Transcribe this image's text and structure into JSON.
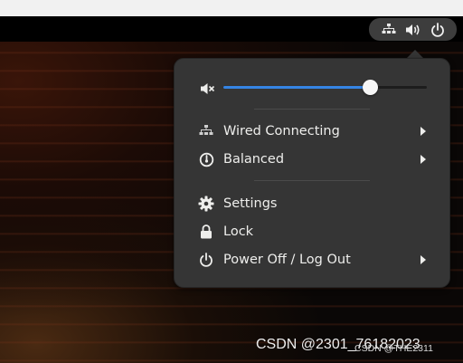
{
  "top_bar": {
    "status_icons": [
      "network-wired-icon",
      "volume-icon",
      "power-icon"
    ]
  },
  "volume": {
    "icon": "speaker-muted-icon",
    "level": 0.72
  },
  "menu": {
    "network": {
      "label": "Wired Connecting",
      "icon": "network-wired-icon"
    },
    "power_mode": {
      "label": "Balanced",
      "icon": "power-profile-icon"
    },
    "settings": {
      "label": "Settings",
      "icon": "gear-icon"
    },
    "lock": {
      "label": "Lock",
      "icon": "lock-icon"
    },
    "power_off": {
      "label": "Power Off / Log Out",
      "icon": "power-icon"
    }
  },
  "watermark": {
    "text": "CSDN @2301_76182023",
    "small_text": "CSDN @THE2311"
  },
  "colors": {
    "accent": "#3584e4",
    "popover_bg": "#353535",
    "text": "#eeeeec"
  }
}
